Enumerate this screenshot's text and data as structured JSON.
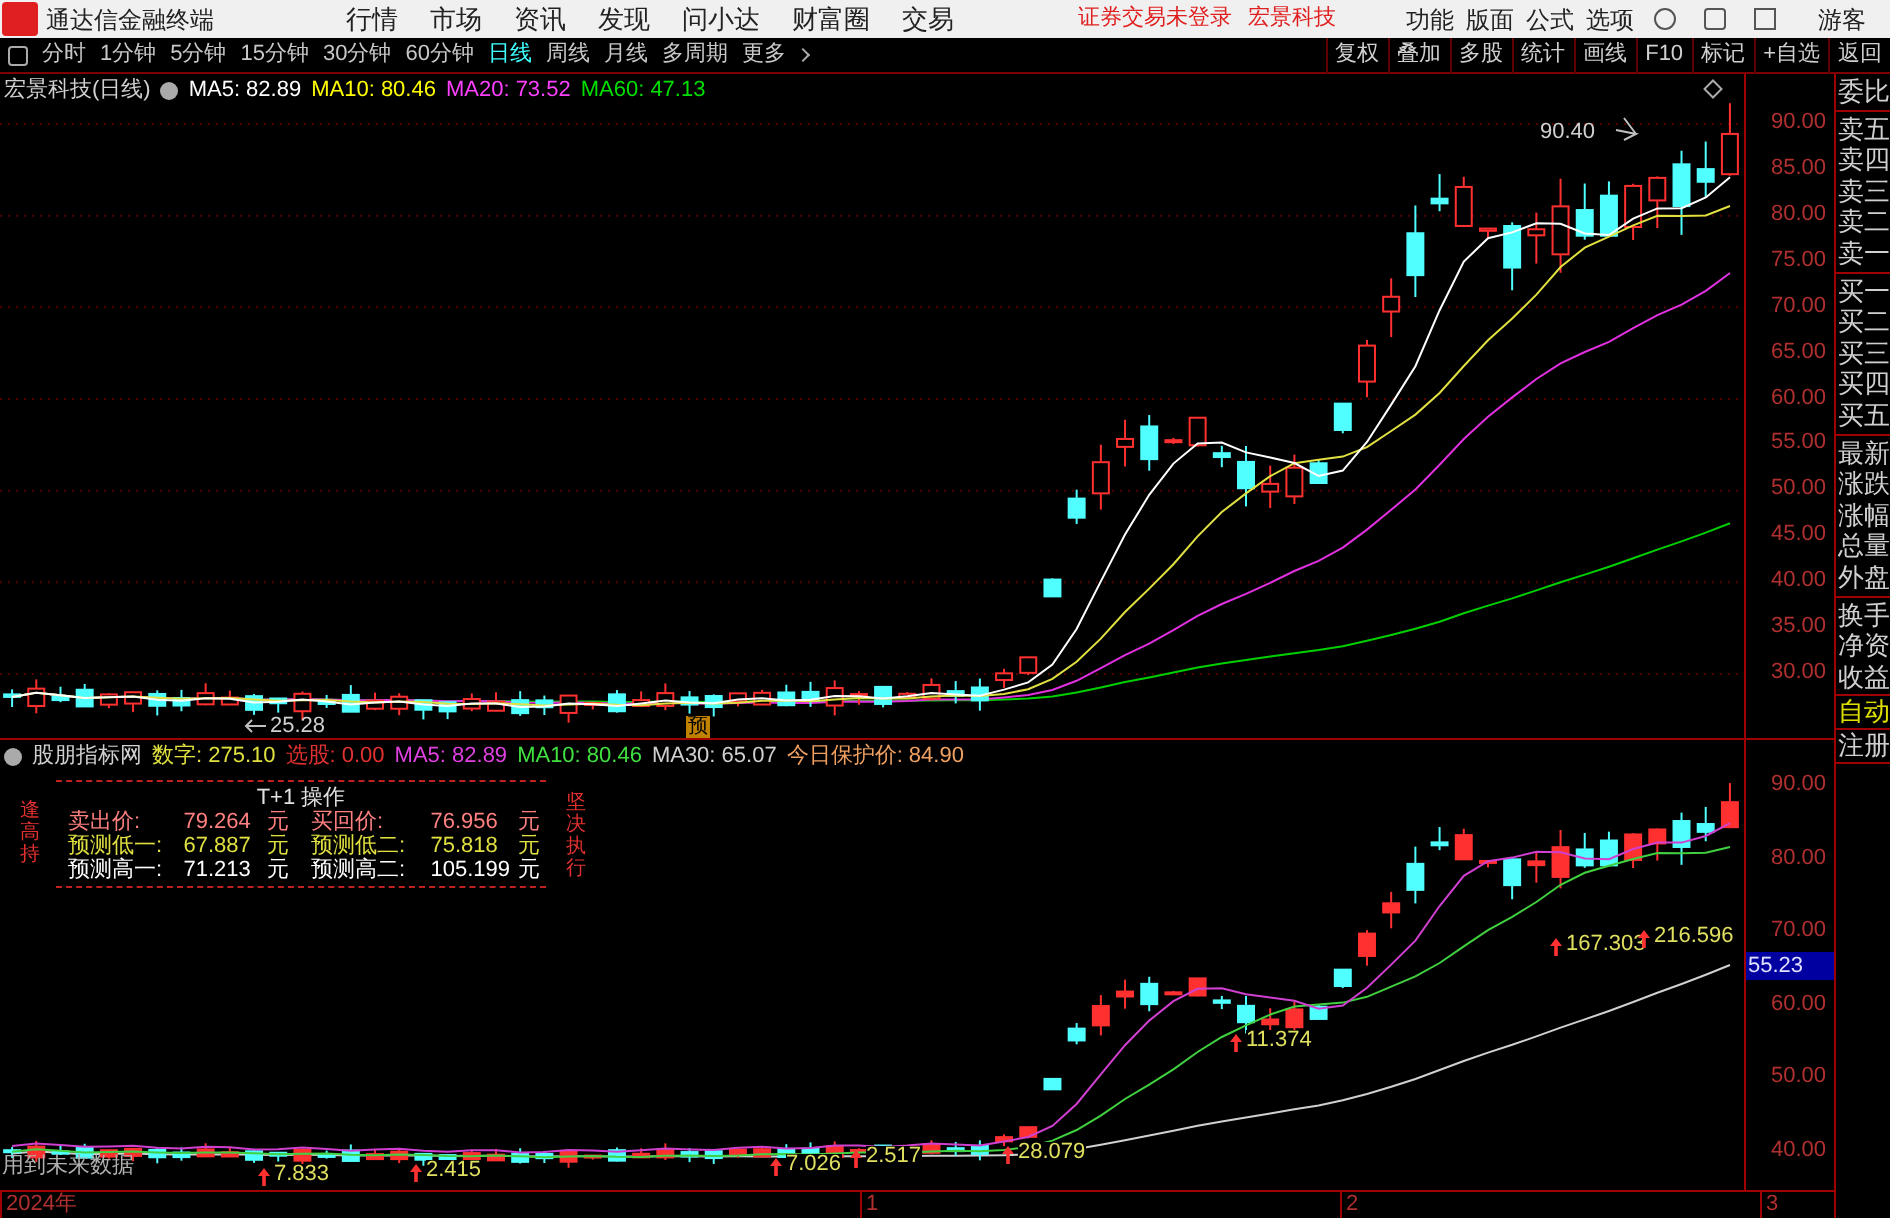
{
  "app": {
    "title": "通达信金融终端"
  },
  "menu": [
    "行情",
    "市场",
    "资讯",
    "发现",
    "问小达",
    "财富圈",
    "交易"
  ],
  "notice": "证券交易未登录",
  "stock_link": "宏景科技",
  "right_menu": [
    "功能",
    "版面",
    "公式",
    "选项"
  ],
  "user": "游客",
  "periods": [
    {
      "label": "分时",
      "selected": false
    },
    {
      "label": "1分钟",
      "selected": false
    },
    {
      "label": "5分钟",
      "selected": false
    },
    {
      "label": "15分钟",
      "selected": false
    },
    {
      "label": "30分钟",
      "selected": false
    },
    {
      "label": "60分钟",
      "selected": false
    },
    {
      "label": "日线",
      "selected": true
    },
    {
      "label": "周线",
      "selected": false
    },
    {
      "label": "月线",
      "selected": false
    },
    {
      "label": "多周期",
      "selected": false
    },
    {
      "label": "更多",
      "selected": false
    }
  ],
  "tools": [
    "复权",
    "叠加",
    "多股",
    "统计",
    "画线",
    "F10",
    "标记",
    "+自选",
    "返回"
  ],
  "main_chart": {
    "title": "宏景科技(日线)",
    "ma": [
      {
        "label": "MA5: 82.89",
        "color": "#ffffff"
      },
      {
        "label": "MA10: 80.46",
        "color": "#ffff00"
      },
      {
        "label": "MA20: 73.52",
        "color": "#ff40ff"
      },
      {
        "label": "MA60: 47.13",
        "color": "#00e000"
      }
    ],
    "yticks": [
      "90.00",
      "85.00",
      "80.00",
      "75.00",
      "70.00",
      "65.00",
      "60.00",
      "55.00",
      "50.00",
      "45.00",
      "40.00",
      "35.00",
      "30.00"
    ],
    "high_label": "90.40",
    "low_label": "25.28",
    "marker": "预"
  },
  "sidebar": {
    "groups": [
      [
        "委比"
      ],
      [
        "卖五",
        "卖四",
        "卖三",
        "卖二",
        "卖一"
      ],
      [
        "买一",
        "买二",
        "买三",
        "买四",
        "买五"
      ],
      [
        "最新",
        "涨跌",
        "涨幅",
        "总量",
        "外盘"
      ],
      [
        "换手",
        "净资",
        "收益"
      ]
    ],
    "buttons": [
      "自动",
      "注册"
    ]
  },
  "indicator": {
    "title": "股朋指标网",
    "values": [
      {
        "label": "数字: 275.10",
        "color": "#e0e040"
      },
      {
        "label": "选股: 0.00",
        "color": "#e03030"
      },
      {
        "label": "MA5: 82.89",
        "color": "#e040e0"
      },
      {
        "label": "MA10: 80.46",
        "color": "#40e040"
      },
      {
        "label": "MA30: 65.07",
        "color": "#d0d0d0"
      },
      {
        "label": "今日保护价: 84.90",
        "color": "#f0a060"
      }
    ],
    "side_left": "逢高持",
    "side_right": "坚决执行",
    "table": {
      "title": "T+1 操作",
      "rows": [
        {
          "color": "#ff8080",
          "cells": [
            "卖出价:",
            "79.264",
            "元",
            "买回价:",
            "76.956",
            "元"
          ]
        },
        {
          "color": "#e0e040",
          "cells": [
            "预测低一:",
            "67.887",
            "元",
            "预测低二:",
            "75.818",
            "元"
          ]
        },
        {
          "color": "#ffffff",
          "cells": [
            "预测高一:",
            "71.213",
            "元",
            "预测高二:",
            "105.199",
            "元"
          ]
        }
      ]
    },
    "yticks": [
      "90.00",
      "80.00",
      "70.00",
      "60.00",
      "50.00",
      "40.00"
    ],
    "current": "55.23",
    "labels": [
      "167.303",
      "216.596",
      "11.374",
      "28.079",
      "7.026",
      "2.517",
      "7.833",
      "2.415"
    ],
    "note": "用到未来数据"
  },
  "x_axis": [
    "2024年",
    "1",
    "2",
    "3"
  ]
}
